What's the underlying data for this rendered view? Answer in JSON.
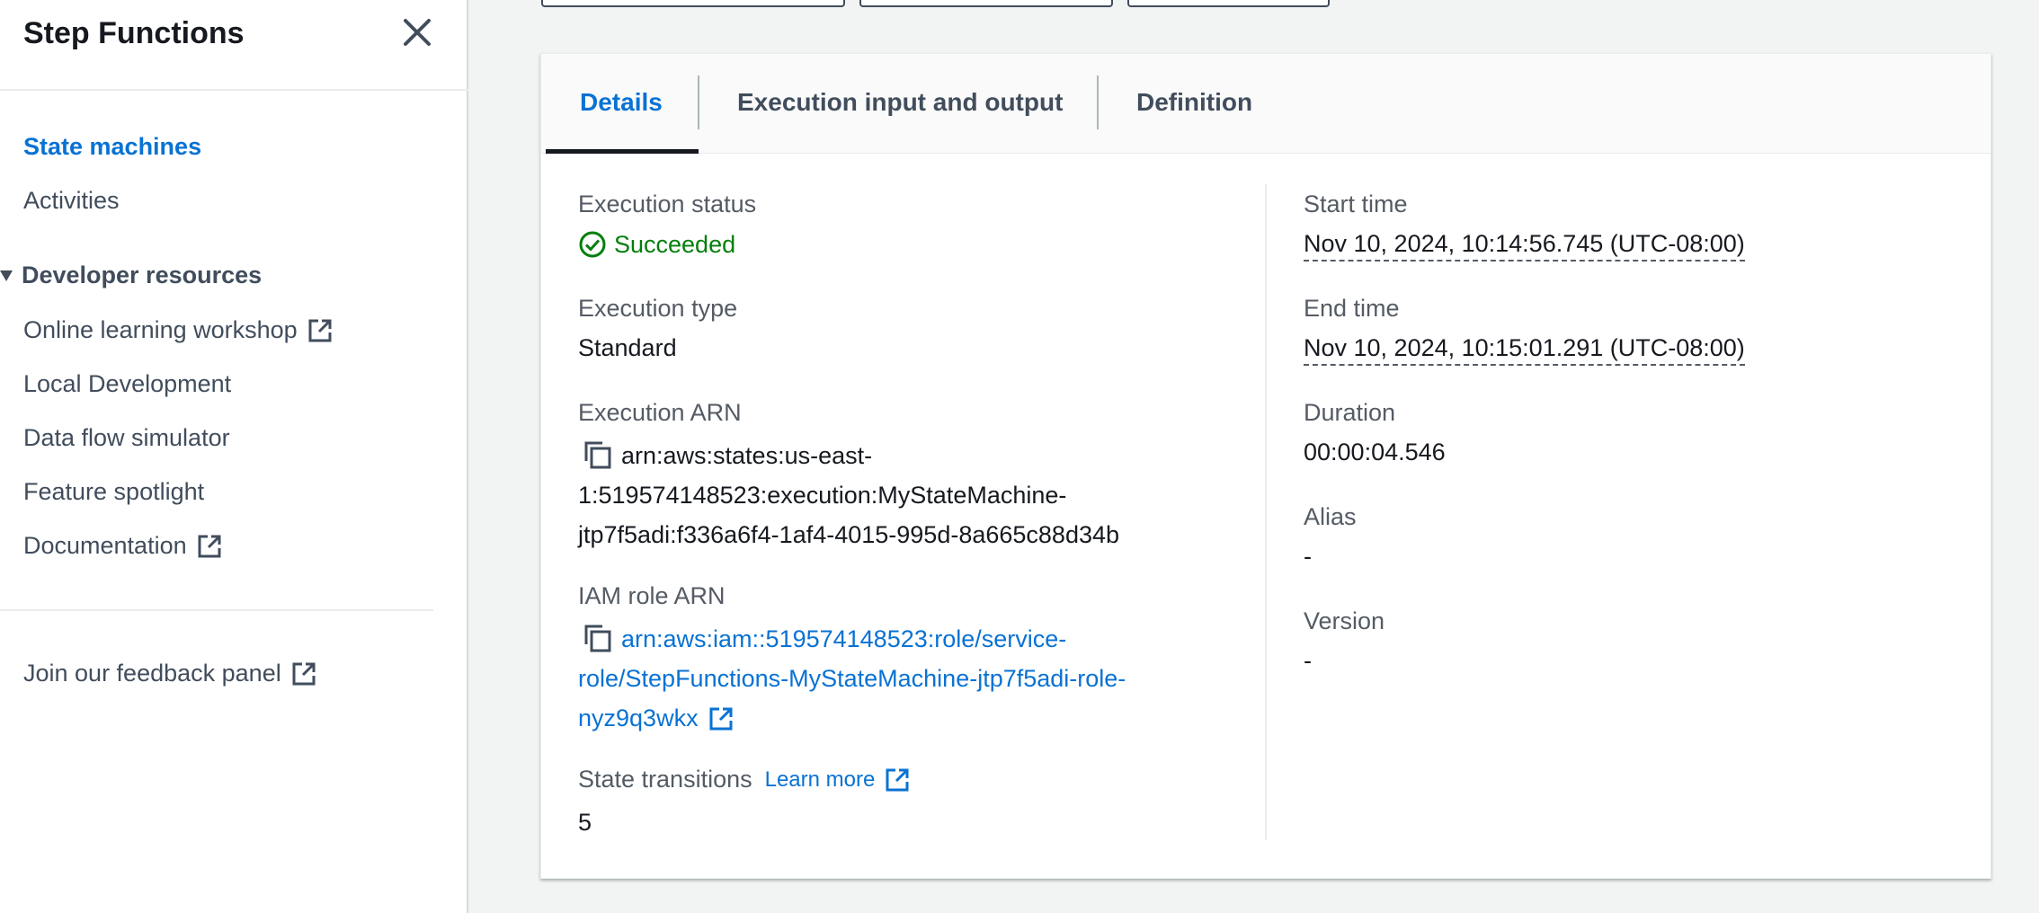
{
  "sidebar": {
    "title": "Step Functions",
    "items": [
      {
        "label": "State machines",
        "active": true
      },
      {
        "label": "Activities"
      }
    ],
    "section_label": "Developer resources",
    "dev_items": [
      {
        "label": "Online learning workshop",
        "external": true
      },
      {
        "label": "Local Development"
      },
      {
        "label": "Data flow simulator"
      },
      {
        "label": "Feature spotlight"
      },
      {
        "label": "Documentation",
        "external": true
      }
    ],
    "feedback_label": "Join our feedback panel"
  },
  "tabs": [
    {
      "label": "Details",
      "active": true
    },
    {
      "label": "Execution input and output"
    },
    {
      "label": "Definition"
    }
  ],
  "details": {
    "execution_status": {
      "label": "Execution status",
      "value": "Succeeded"
    },
    "execution_type": {
      "label": "Execution type",
      "value": "Standard"
    },
    "execution_arn": {
      "label": "Execution ARN",
      "lines": [
        "arn:aws:states:us-east-",
        "1:519574148523:execution:MyStateMachine-",
        "jtp7f5adi:f336a6f4-1af4-4015-995d-8a665c88d34b"
      ]
    },
    "iam_role_arn": {
      "label": "IAM role ARN",
      "lines": [
        "arn:aws:iam::519574148523:role/service-",
        "role/StepFunctions-MyStateMachine-jtp7f5adi-role-",
        "nyz9q3wkx"
      ]
    },
    "state_transitions": {
      "label": "State transitions",
      "learn_more": "Learn more",
      "value": "5"
    },
    "start_time": {
      "label": "Start time",
      "value": "Nov 10, 2024, 10:14:56.745 (UTC-08:00)"
    },
    "end_time": {
      "label": "End time",
      "value": "Nov 10, 2024, 10:15:01.291 (UTC-08:00)"
    },
    "duration": {
      "label": "Duration",
      "value": "00:00:04.546"
    },
    "alias": {
      "label": "Alias",
      "value": "-"
    },
    "version": {
      "label": "Version",
      "value": "-"
    }
  },
  "colors": {
    "link": "#0972d3",
    "success": "#037f0c",
    "text": "#16191f",
    "label": "#545b64"
  }
}
